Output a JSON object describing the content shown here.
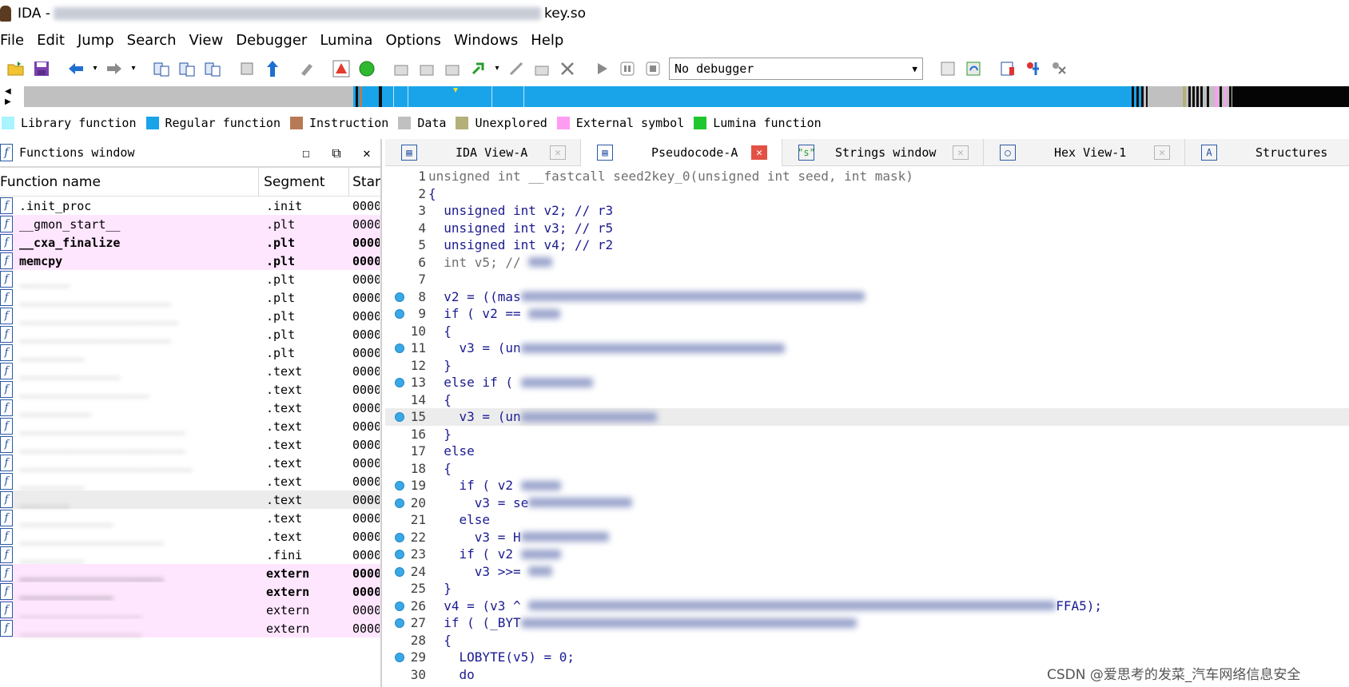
{
  "window": {
    "app_title": "IDA -",
    "file_suffix": "key.so"
  },
  "menu": [
    "File",
    "Edit",
    "Jump",
    "Search",
    "View",
    "Debugger",
    "Lumina",
    "Options",
    "Windows",
    "Help"
  ],
  "toolbar": {
    "debugger_select": "No debugger"
  },
  "legend": [
    {
      "label": "Library function",
      "color": "#a8f4ff"
    },
    {
      "label": "Regular function",
      "color": "#19a4ea"
    },
    {
      "label": "Instruction",
      "color": "#b87a54"
    },
    {
      "label": "Data",
      "color": "#c0c0c0"
    },
    {
      "label": "Unexplored",
      "color": "#b3b07a"
    },
    {
      "label": "External symbol",
      "color": "#ff9cf2"
    },
    {
      "label": "Lumina function",
      "color": "#1fc72e"
    }
  ],
  "functions_window": {
    "title": "Functions window",
    "columns": [
      "Function name",
      "Segment",
      "Star"
    ],
    "rows": [
      {
        "name": ".init_proc",
        "segment": ".init",
        "start": "0000",
        "style": "normal",
        "blur": false
      },
      {
        "name": "__gmon_start__",
        "segment": ".plt",
        "start": "0000",
        "style": "ext",
        "blur": false
      },
      {
        "name": "__cxa_finalize",
        "segment": ".plt",
        "start": "0000",
        "style": "ext-bold",
        "blur": false
      },
      {
        "name": "memcpy",
        "segment": ".plt",
        "start": "0000",
        "style": "ext-bold",
        "blur": false
      },
      {
        "name": "_______",
        "segment": ".plt",
        "start": "0000",
        "style": "normal",
        "blur": true
      },
      {
        "name": "_____________________",
        "segment": ".plt",
        "start": "0000",
        "style": "normal",
        "blur": true
      },
      {
        "name": "______________________",
        "segment": ".plt",
        "start": "0000",
        "style": "normal",
        "blur": true
      },
      {
        "name": "_____________________",
        "segment": ".plt",
        "start": "0000",
        "style": "normal",
        "blur": true
      },
      {
        "name": "_________",
        "segment": ".plt",
        "start": "0000",
        "style": "normal",
        "blur": true
      },
      {
        "name": "______________",
        "segment": ".text",
        "start": "0000",
        "style": "normal",
        "blur": true
      },
      {
        "name": "__________________",
        "segment": ".text",
        "start": "0000",
        "style": "normal",
        "blur": true
      },
      {
        "name": "__________",
        "segment": ".text",
        "start": "0000",
        "style": "normal",
        "blur": true
      },
      {
        "name": "_______________________",
        "segment": ".text",
        "start": "0000",
        "style": "normal",
        "blur": true
      },
      {
        "name": "_______________________",
        "segment": ".text",
        "start": "0000",
        "style": "normal",
        "blur": true
      },
      {
        "name": "________________________",
        "segment": ".text",
        "start": "0000",
        "style": "normal",
        "blur": true
      },
      {
        "name": "_________",
        "segment": ".text",
        "start": "0000",
        "style": "normal",
        "blur": true
      },
      {
        "name": "_______",
        "segment": ".text",
        "start": "0000",
        "style": "sel",
        "blur": true
      },
      {
        "name": "_____________",
        "segment": ".text",
        "start": "0000",
        "style": "normal",
        "blur": true
      },
      {
        "name": "____________________",
        "segment": ".text",
        "start": "0000",
        "style": "normal",
        "blur": true
      },
      {
        "name": "_________",
        "segment": ".fini",
        "start": "0000",
        "style": "normal",
        "blur": true
      },
      {
        "name": "____________________",
        "segment": "extern",
        "start": "0000",
        "style": "ext-bold",
        "blur": true
      },
      {
        "name": "_____________",
        "segment": "extern",
        "start": "0000",
        "style": "ext-bold",
        "blur": true
      },
      {
        "name": "_________________",
        "segment": "extern",
        "start": "0000",
        "style": "ext",
        "blur": true
      },
      {
        "name": "_________________",
        "segment": "extern",
        "start": "0000",
        "style": "ext",
        "blur": true
      }
    ]
  },
  "tabs": [
    {
      "label": "IDA View-A",
      "active": false,
      "icon": "graph-view-icon"
    },
    {
      "label": "Pseudocode-A",
      "active": true,
      "icon": "pseudocode-icon"
    },
    {
      "label": "Strings window",
      "active": false,
      "icon": "strings-icon"
    },
    {
      "label": "Hex View-1",
      "active": false,
      "icon": "hex-view-icon"
    },
    {
      "label": "Structures",
      "active": false,
      "icon": "structures-icon"
    }
  ],
  "pseudocode": [
    {
      "n": "1",
      "bp": false,
      "hl": false,
      "text": "unsigned int __fastcall seed2key_0(unsigned int seed, int mask)",
      "blur": 0,
      "gray": true
    },
    {
      "n": "2",
      "bp": false,
      "hl": false,
      "text": "{",
      "blur": 0
    },
    {
      "n": "3",
      "bp": false,
      "hl": false,
      "text": "  unsigned int v2; // r3",
      "blur": 0
    },
    {
      "n": "4",
      "bp": false,
      "hl": false,
      "text": "  unsigned int v3; // r5",
      "blur": 0
    },
    {
      "n": "5",
      "bp": false,
      "hl": false,
      "text": "  unsigned int v4; // r2",
      "blur": 0
    },
    {
      "n": "6",
      "bp": false,
      "hl": false,
      "text": "  int v5; // ",
      "blur": 30,
      "gray": true
    },
    {
      "n": "7",
      "bp": false,
      "hl": false,
      "text": "",
      "blur": 0
    },
    {
      "n": "8",
      "bp": true,
      "hl": false,
      "text": "  v2 = ((mas",
      "blur": 430
    },
    {
      "n": "9",
      "bp": true,
      "hl": false,
      "text": "  if ( v2 == ",
      "blur": 40
    },
    {
      "n": "10",
      "bp": false,
      "hl": false,
      "text": "  {",
      "blur": 0
    },
    {
      "n": "11",
      "bp": true,
      "hl": false,
      "text": "    v3 = (un",
      "blur": 330
    },
    {
      "n": "12",
      "bp": false,
      "hl": false,
      "text": "  }",
      "blur": 0
    },
    {
      "n": "13",
      "bp": true,
      "hl": false,
      "text": "  else if ( ",
      "blur": 90
    },
    {
      "n": "14",
      "bp": false,
      "hl": false,
      "text": "  {",
      "blur": 0
    },
    {
      "n": "15",
      "bp": true,
      "hl": true,
      "text": "    v3 = (un",
      "blur": 170
    },
    {
      "n": "16",
      "bp": false,
      "hl": false,
      "text": "  }",
      "blur": 0
    },
    {
      "n": "17",
      "bp": false,
      "hl": false,
      "text": "  else",
      "blur": 0
    },
    {
      "n": "18",
      "bp": false,
      "hl": false,
      "text": "  {",
      "blur": 0
    },
    {
      "n": "19",
      "bp": true,
      "hl": false,
      "text": "    if ( v2 ",
      "blur": 50
    },
    {
      "n": "20",
      "bp": true,
      "hl": false,
      "text": "      v3 = se",
      "blur": 130
    },
    {
      "n": "21",
      "bp": false,
      "hl": false,
      "text": "    else",
      "blur": 0
    },
    {
      "n": "22",
      "bp": true,
      "hl": false,
      "text": "      v3 = H",
      "blur": 110
    },
    {
      "n": "23",
      "bp": true,
      "hl": false,
      "text": "    if ( v2 ",
      "blur": 50
    },
    {
      "n": "24",
      "bp": true,
      "hl": false,
      "text": "      v3 >>= ",
      "blur": 30
    },
    {
      "n": "25",
      "bp": false,
      "hl": false,
      "text": "  }",
      "blur": 0
    },
    {
      "n": "26",
      "bp": true,
      "hl": false,
      "text": "  v4 = (v3 ^ ",
      "blur": 660,
      "tail": "FFA5);"
    },
    {
      "n": "27",
      "bp": true,
      "hl": false,
      "text": "  if ( (_BYT",
      "blur": 420
    },
    {
      "n": "28",
      "bp": false,
      "hl": false,
      "text": "  {",
      "blur": 0
    },
    {
      "n": "29",
      "bp": true,
      "hl": false,
      "text": "    LOBYTE(v5) = 0;",
      "blur": 0
    },
    {
      "n": "30",
      "bp": false,
      "hl": false,
      "text": "    do",
      "blur": 0
    }
  ],
  "watermark": "CSDN @爱思考的发菜_汽车网络信息安全"
}
